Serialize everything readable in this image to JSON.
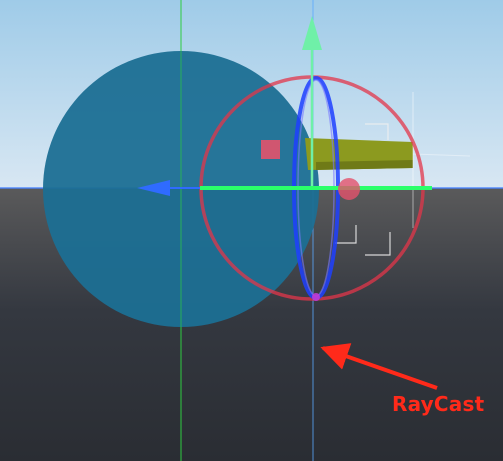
{
  "viewport": {
    "sky_top": "#9fcbe8",
    "sky_horizon": "#d7e6f2",
    "ground_top": "#5b5b5c",
    "ground_bottom": "#2a2d33",
    "grid_axis_x": "#3a7bff",
    "grid_axis_y": "#2ecc40"
  },
  "objects": {
    "sphere_color": "#1c6f93",
    "box_color": "#8c9a1f",
    "marker_color": "#e3536c"
  },
  "gizmo": {
    "rotate_ring_color": "#e3364a",
    "rotate_ring_blue": "#1f3fff",
    "translate_y_color": "#6ff0a8",
    "translate_x_color": "#2f6bff",
    "translate_bar_color": "#2bff6a"
  },
  "annotation": {
    "label": "RayCast",
    "color": "#ff2a1a"
  }
}
